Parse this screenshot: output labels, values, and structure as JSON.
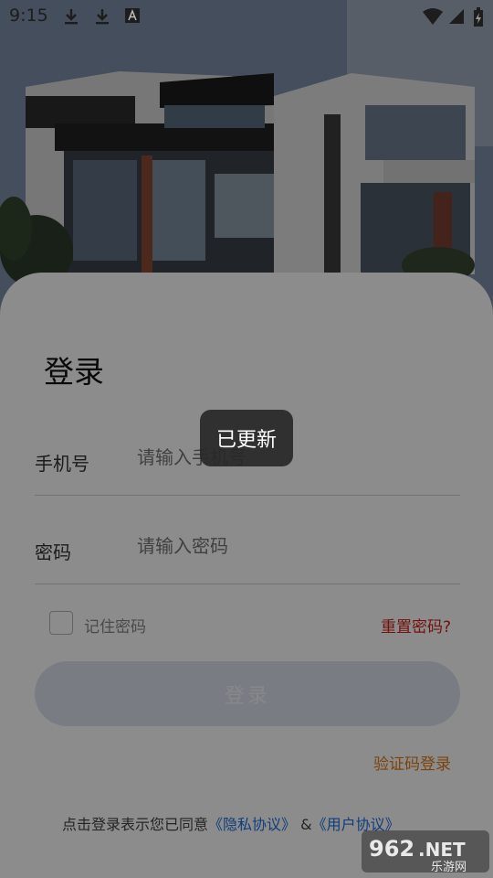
{
  "status_bar": {
    "time": "9:15",
    "icons": [
      "download-icon",
      "download-icon",
      "font-a-icon",
      "wifi-icon",
      "signal-icon",
      "battery-charging-icon"
    ]
  },
  "login": {
    "title": "登录",
    "phone_label": "手机号",
    "phone_placeholder": "请输入手机号",
    "password_label": "密码",
    "password_placeholder": "请输入密码",
    "remember_label": "记住密码",
    "reset_label": "重置密码?",
    "login_button": "登录",
    "code_login": "验证码登录",
    "agreement_prefix": "点击登录表示您已同意",
    "privacy_link": "《隐私协议》",
    "amp": "&",
    "user_link": "《用户协议》"
  },
  "toast": {
    "text": "已更新"
  },
  "watermark": {
    "text1": "962",
    "text2": ".NET",
    "text3": "乐游网"
  },
  "colors": {
    "reset": "#d0201b",
    "code_login": "#e07a18",
    "link": "#1e6fe0",
    "button_bg": "#dde3ef"
  }
}
